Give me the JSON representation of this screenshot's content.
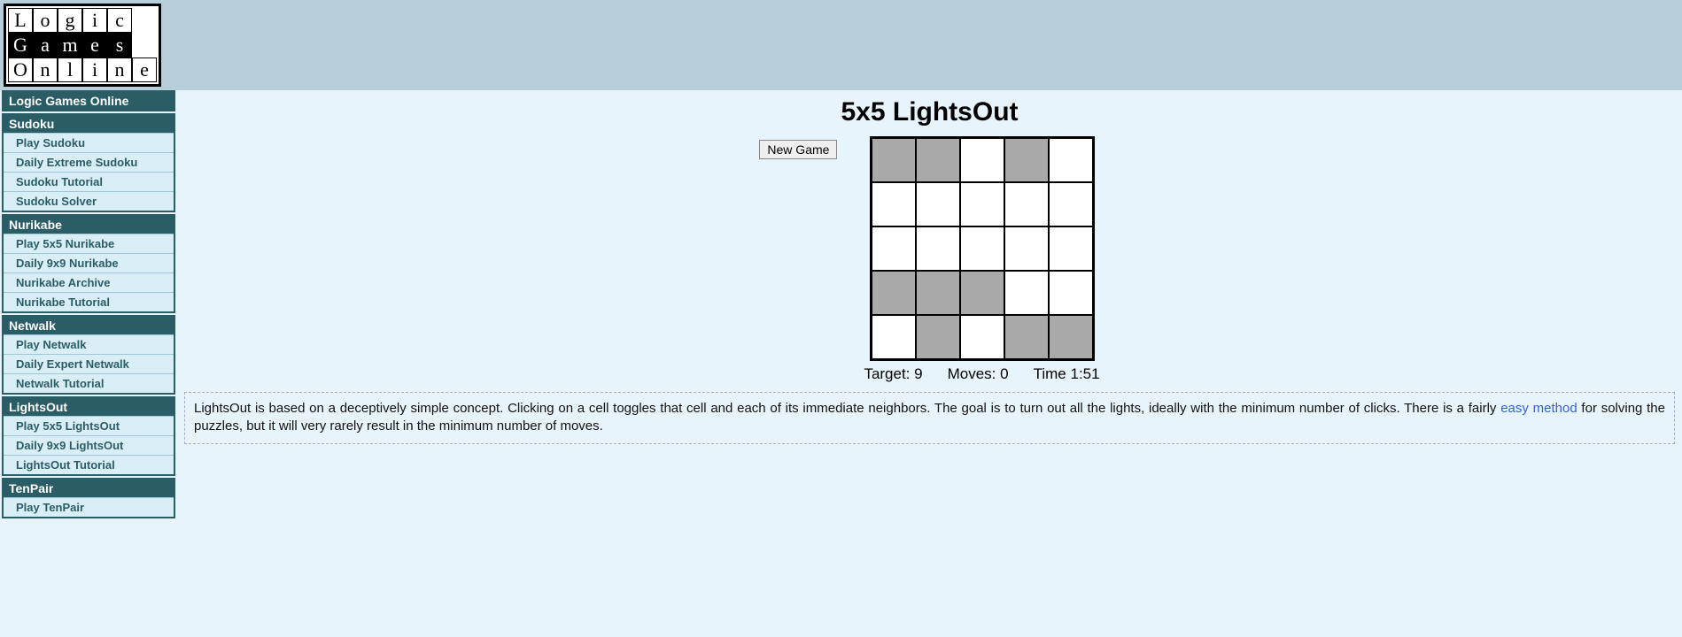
{
  "logo": {
    "rows": [
      [
        {
          "c": "L"
        },
        {
          "c": "o"
        },
        {
          "c": "g"
        },
        {
          "c": "i"
        },
        {
          "c": "c"
        }
      ],
      [
        {
          "c": "G",
          "inv": true
        },
        {
          "c": "a",
          "inv": true
        },
        {
          "c": "m",
          "inv": true
        },
        {
          "c": "e",
          "inv": true
        },
        {
          "c": "s",
          "inv": true
        }
      ],
      [
        {
          "c": "O"
        },
        {
          "c": "n"
        },
        {
          "c": "l"
        },
        {
          "c": "i"
        },
        {
          "c": "n"
        },
        {
          "c": "e"
        }
      ]
    ]
  },
  "sidebar": [
    {
      "header": "Logic Games Online",
      "items": []
    },
    {
      "header": "Sudoku",
      "items": [
        "Play Sudoku",
        "Daily Extreme Sudoku",
        "Sudoku Tutorial",
        "Sudoku Solver"
      ]
    },
    {
      "header": "Nurikabe",
      "items": [
        "Play 5x5 Nurikabe",
        "Daily 9x9 Nurikabe",
        "Nurikabe Archive",
        "Nurikabe Tutorial"
      ]
    },
    {
      "header": "Netwalk",
      "items": [
        "Play Netwalk",
        "Daily Expert Netwalk",
        "Netwalk Tutorial"
      ]
    },
    {
      "header": "LightsOut",
      "items": [
        "Play 5x5 LightsOut",
        "Daily 9x9 LightsOut",
        "LightsOut Tutorial"
      ]
    },
    {
      "header": "TenPair",
      "items": [
        "Play TenPair"
      ]
    }
  ],
  "title": "5x5 LightsOut",
  "controls": {
    "new_game": "New Game"
  },
  "board": {
    "size": 5,
    "grid": [
      [
        1,
        1,
        0,
        1,
        0
      ],
      [
        0,
        0,
        0,
        0,
        0
      ],
      [
        0,
        0,
        0,
        0,
        0
      ],
      [
        1,
        1,
        1,
        0,
        0
      ],
      [
        0,
        1,
        0,
        1,
        1
      ]
    ]
  },
  "stats": {
    "target_label": "Target: ",
    "target_value": "9",
    "moves_label": "Moves: ",
    "moves_value": "0",
    "time_label": "Time ",
    "time_value": "1:51"
  },
  "description": {
    "part1": "LightsOut is based on a deceptively simple concept. Clicking on a cell toggles that cell and each of its immediate neighbors. The goal is to turn out all the lights, ideally with the minimum number of clicks. There is a fairly ",
    "link_text": "easy method",
    "part2": " for solving the puzzles, but it will very rarely result in the minimum number of moves."
  }
}
